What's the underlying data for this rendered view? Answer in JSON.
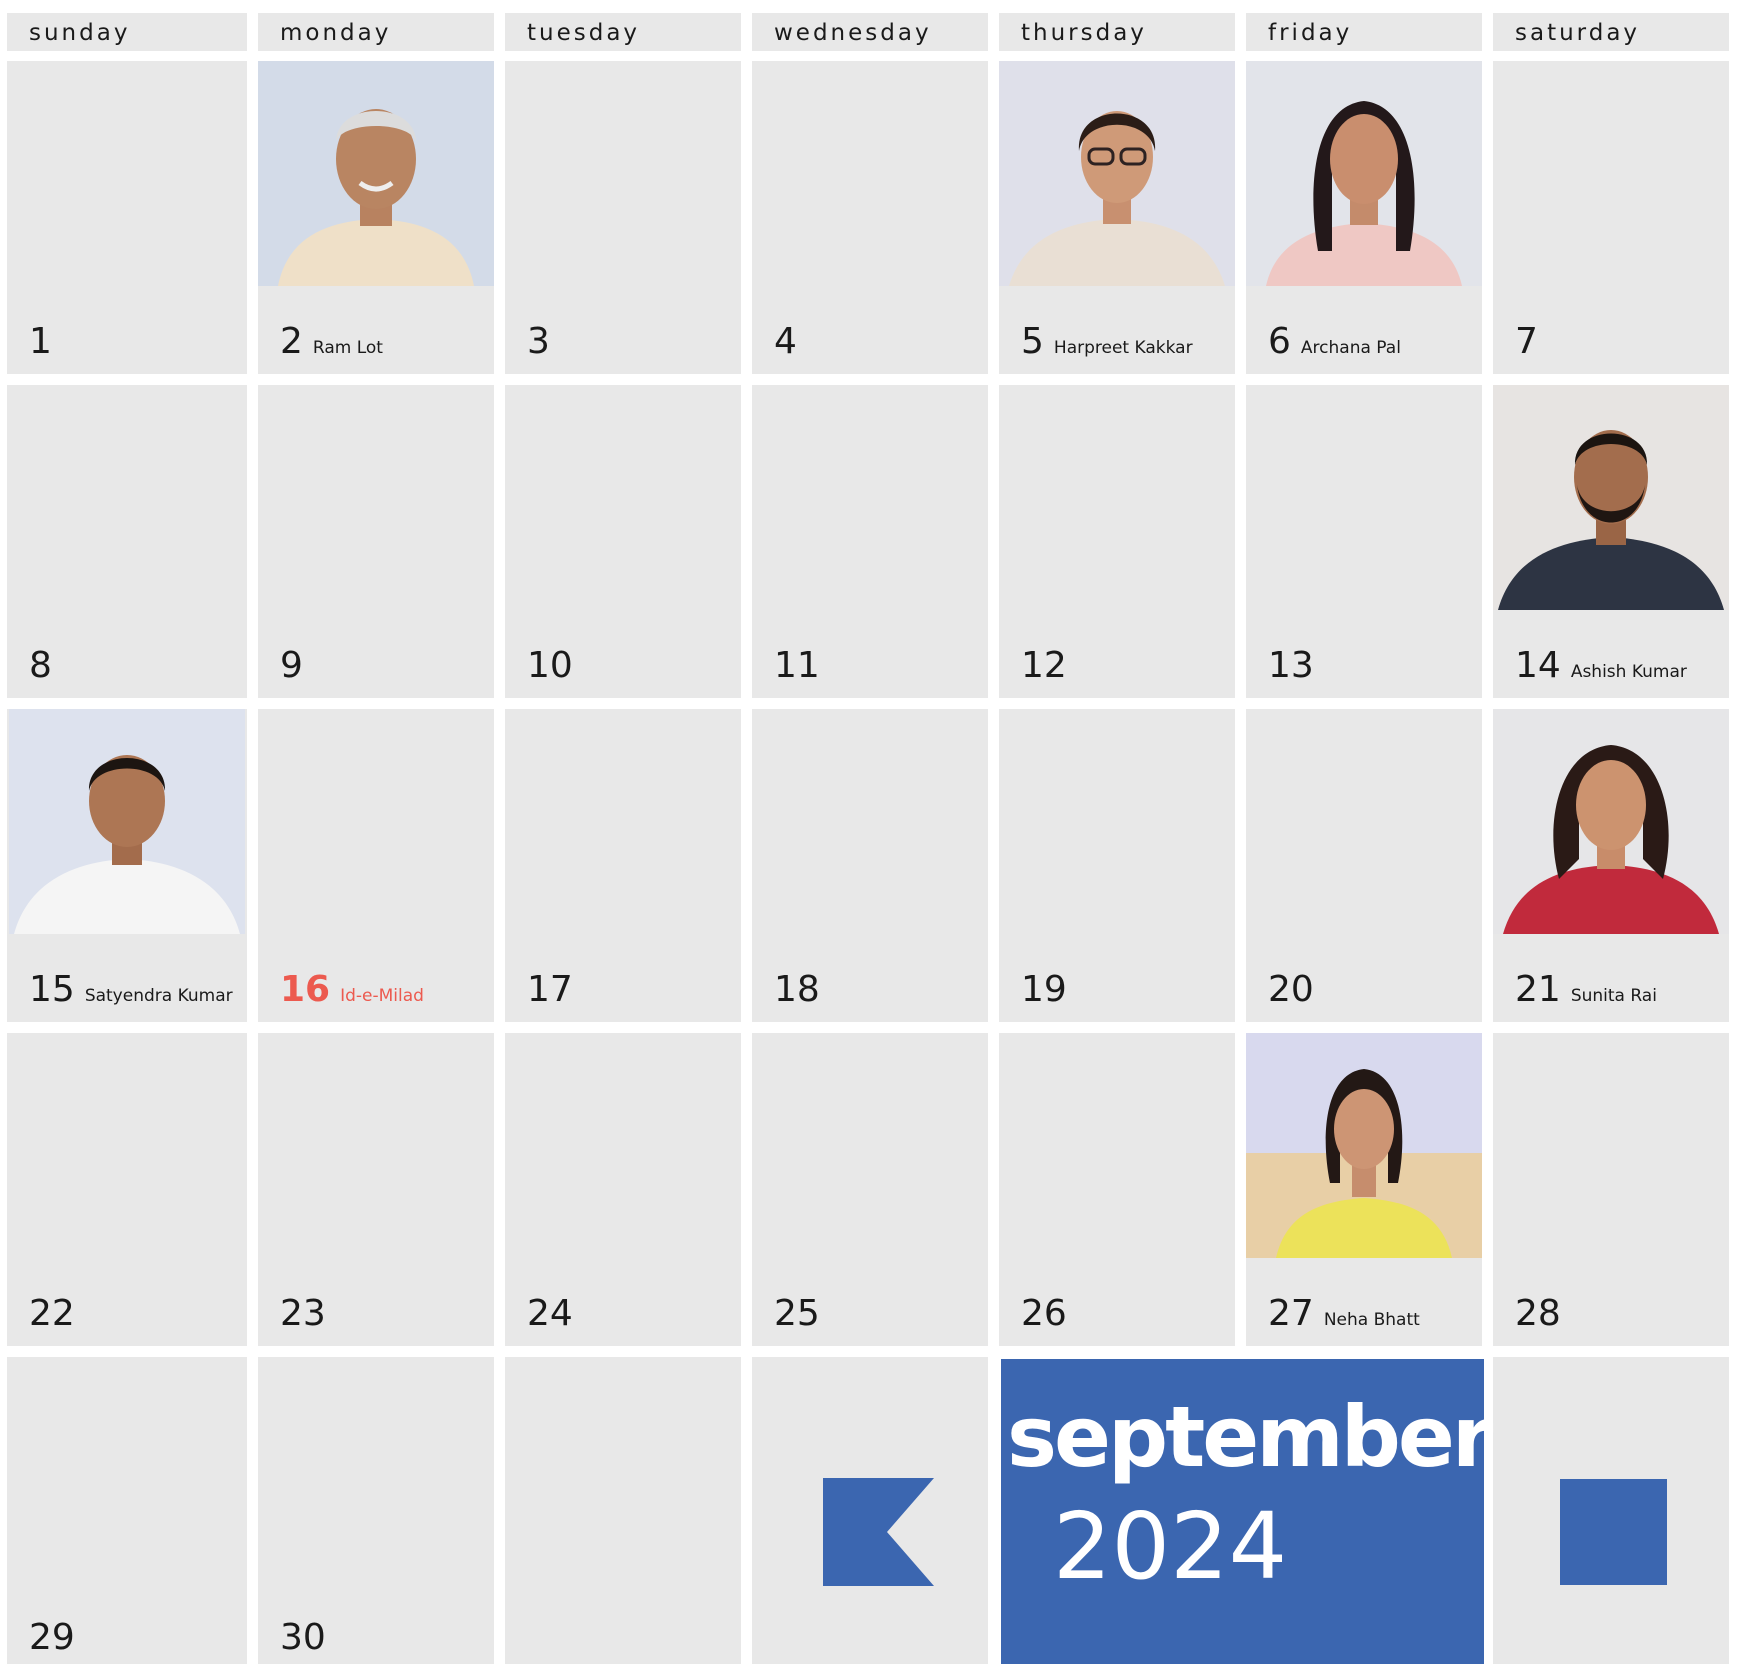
{
  "weekdays": [
    "sunday",
    "monday",
    "tuesday",
    "wednesday",
    "thursday",
    "friday",
    "saturday"
  ],
  "month": "september",
  "year": "2024",
  "colors": {
    "accent": "#3b66b0",
    "holiday": "#ec5a4f",
    "cell": "#e8e8e8"
  },
  "weeks": [
    [
      {
        "day": "1",
        "name": ""
      },
      {
        "day": "2",
        "name": "Ram Lot",
        "photo": "elder-man-portrait"
      },
      {
        "day": "3",
        "name": ""
      },
      {
        "day": "4",
        "name": ""
      },
      {
        "day": "5",
        "name": "Harpreet Kakkar",
        "photo": "woman-glasses-portrait"
      },
      {
        "day": "6",
        "name": "Archana Pal",
        "photo": "woman-pink-top-portrait"
      },
      {
        "day": "7",
        "name": ""
      }
    ],
    [
      {
        "day": "8",
        "name": ""
      },
      {
        "day": "9",
        "name": ""
      },
      {
        "day": "10",
        "name": ""
      },
      {
        "day": "11",
        "name": ""
      },
      {
        "day": "12",
        "name": ""
      },
      {
        "day": "13",
        "name": ""
      },
      {
        "day": "14",
        "name": "Ashish Kumar",
        "photo": "man-beard-portrait"
      }
    ],
    [
      {
        "day": "15",
        "name": "Satyendra Kumar",
        "photo": "man-white-tshirt-portrait"
      },
      {
        "day": "16",
        "name": "Id-e-Milad",
        "holiday": true
      },
      {
        "day": "17",
        "name": ""
      },
      {
        "day": "18",
        "name": ""
      },
      {
        "day": "19",
        "name": ""
      },
      {
        "day": "20",
        "name": ""
      },
      {
        "day": "21",
        "name": "Sunita Rai",
        "photo": "woman-red-top-portrait"
      }
    ],
    [
      {
        "day": "22",
        "name": ""
      },
      {
        "day": "23",
        "name": ""
      },
      {
        "day": "24",
        "name": ""
      },
      {
        "day": "25",
        "name": ""
      },
      {
        "day": "26",
        "name": ""
      },
      {
        "day": "27",
        "name": "Neha Bhatt",
        "photo": "woman-yellow-kurta-portrait"
      },
      {
        "day": "28",
        "name": ""
      }
    ],
    [
      {
        "day": "29",
        "name": ""
      },
      {
        "day": "30",
        "name": ""
      },
      {
        "day": "",
        "name": ""
      },
      {
        "day": "",
        "name": ""
      }
    ]
  ]
}
